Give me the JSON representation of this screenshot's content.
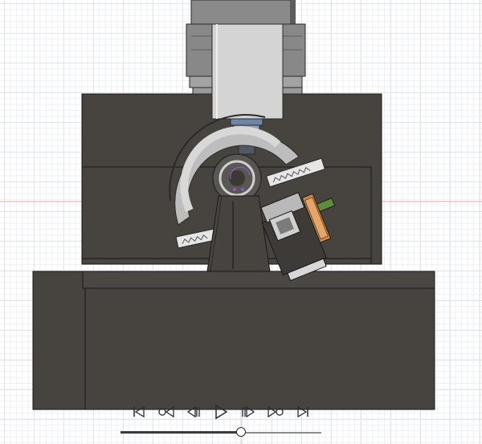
{
  "app": {
    "accent_axis_x": "#f2a3a8",
    "accent_axis_y": "#b7c6e6",
    "grid_color": "#e3e4ea"
  },
  "model": {
    "body_color": "#47433f",
    "spindle_color": "#8a8a8a",
    "spindle_light": "#bdbdbd",
    "sketch_point_color": "#8a5cc8"
  },
  "playback": {
    "controls": [
      {
        "name": "first-frame-icon",
        "icon": "skip-to-start"
      },
      {
        "name": "previous-keyframe-icon",
        "icon": "previous-keyframe"
      },
      {
        "name": "step-back-icon",
        "icon": "step-back"
      },
      {
        "name": "play-icon",
        "icon": "play"
      },
      {
        "name": "step-forward-icon",
        "icon": "step-forward"
      },
      {
        "name": "next-keyframe-icon",
        "icon": "next-keyframe"
      },
      {
        "name": "last-frame-icon",
        "icon": "skip-to-end"
      }
    ],
    "timeline_position": 0.6
  }
}
